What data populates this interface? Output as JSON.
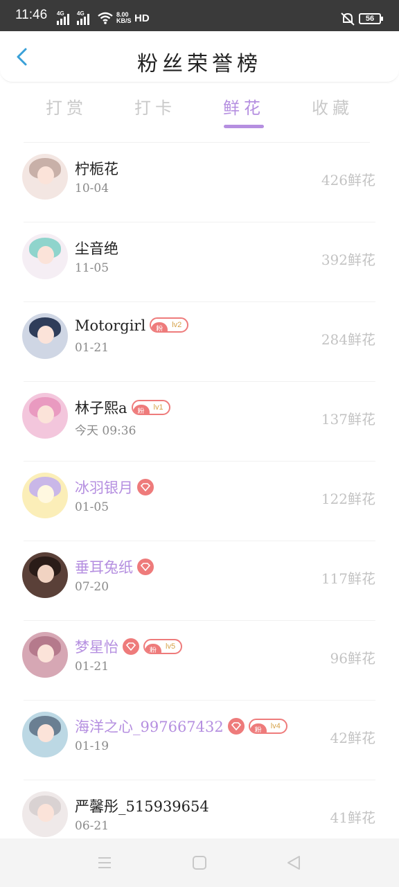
{
  "status_bar": {
    "time": "11:46",
    "signal1": "4G",
    "signal2": "4G",
    "speed_top": "8.00",
    "speed_unit": "KB/S",
    "hd": "HD",
    "battery": "56"
  },
  "header": {
    "title": "粉丝荣誉榜"
  },
  "tabs": [
    {
      "label": "打赏"
    },
    {
      "label": "打卡"
    },
    {
      "label": "鲜花",
      "active": true
    },
    {
      "label": "收藏"
    }
  ],
  "badge": {
    "fan_label": "粉"
  },
  "rows": [
    {
      "name": "柠栀花",
      "date": "10-04",
      "count": "426鲜花",
      "vip": false,
      "avatar_color": "#c8b0a8"
    },
    {
      "name": "尘音绝",
      "date": "11-05",
      "count": "392鲜花",
      "vip": false,
      "avatar_color": "#8fd4cc"
    },
    {
      "name": "Motorgirl",
      "date": "01-21",
      "count": "284鲜花",
      "vip": false,
      "level": "lv2",
      "avatar_color": "#2f3d5a"
    },
    {
      "name": "林子熙a",
      "date": "今天 09:36",
      "count": "137鲜花",
      "vip": false,
      "level": "lv1",
      "avatar_color": "#e99ac0"
    },
    {
      "name": "冰羽银月",
      "date": "01-05",
      "count": "122鲜花",
      "vip": true,
      "avatar_color": "#f2d97a"
    },
    {
      "name": "垂耳兔纸",
      "date": "07-20",
      "count": "117鲜花",
      "vip": true,
      "avatar_color": "#3b2a24"
    },
    {
      "name": "梦星怡",
      "date": "01-21",
      "count": "96鲜花",
      "vip": true,
      "level": "lv5",
      "avatar_color": "#b57a8c"
    },
    {
      "name": "海洋之心_997667432",
      "date": "01-19",
      "count": "42鲜花",
      "vip": true,
      "level": "lv4",
      "avatar_color": "#6a7f92"
    },
    {
      "name": "严馨彤_515939654",
      "date": "06-21",
      "count": "41鲜花",
      "vip": false,
      "avatar_color": "#d9d2d2"
    }
  ]
}
